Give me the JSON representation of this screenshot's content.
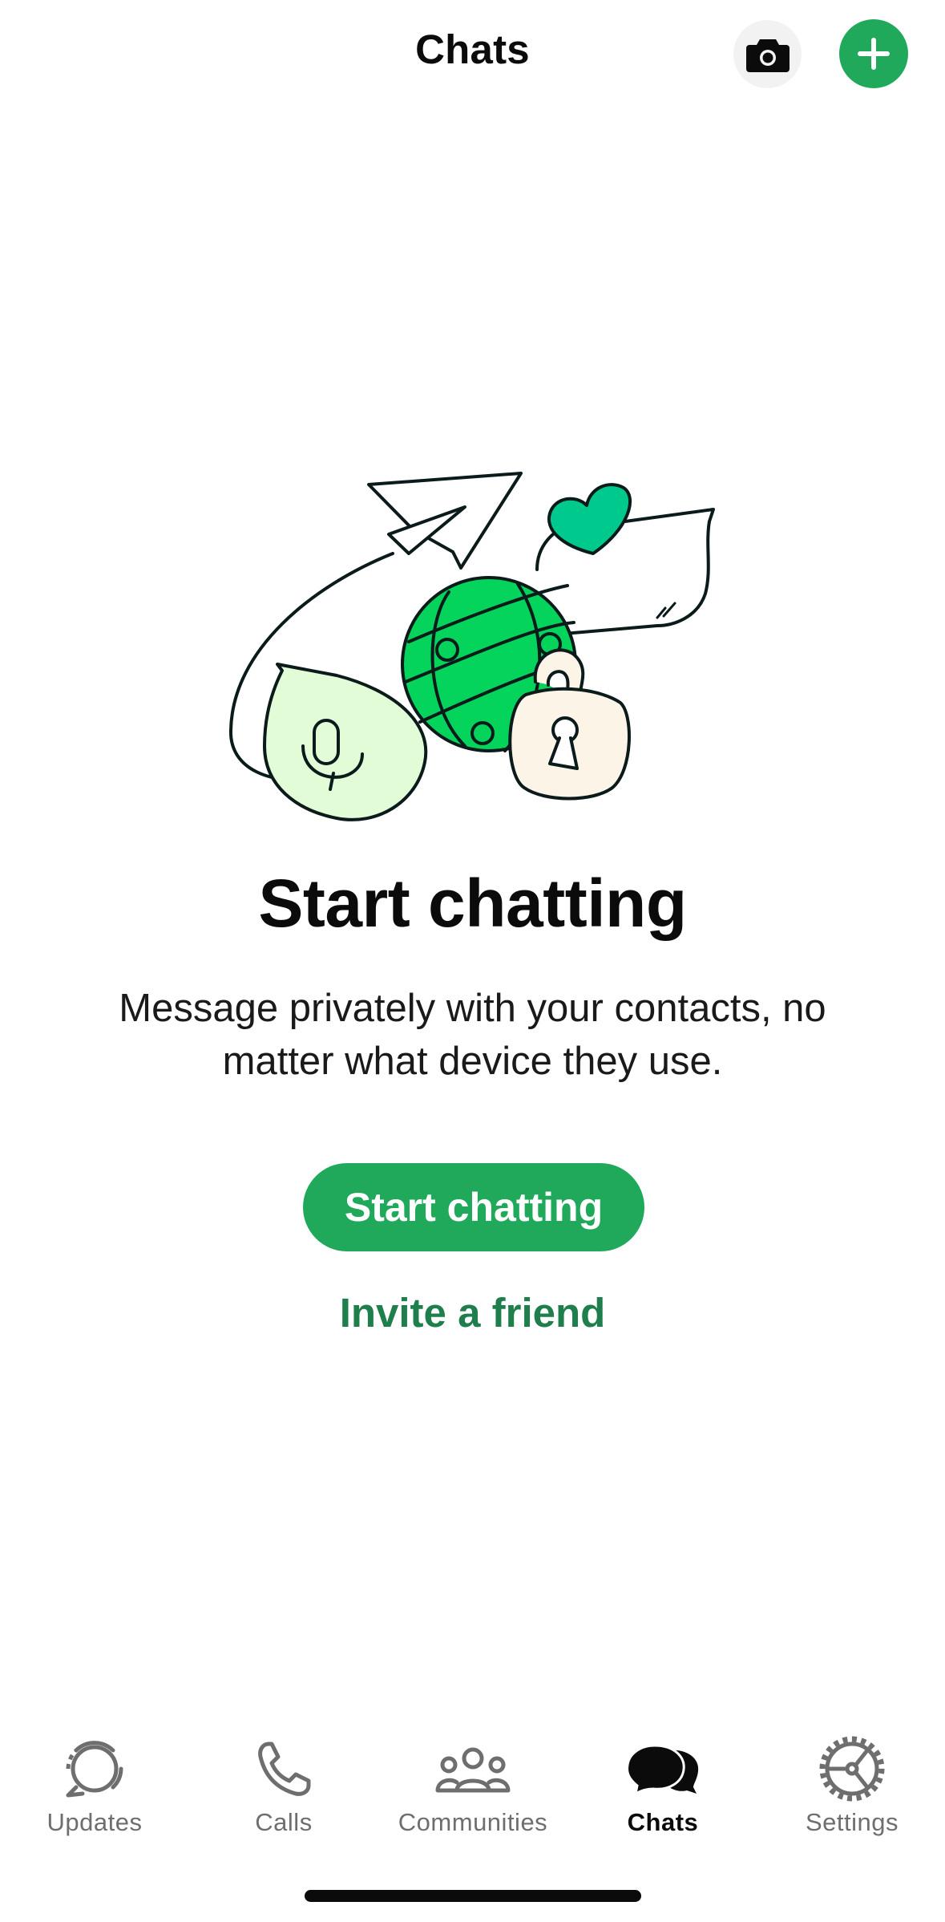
{
  "header": {
    "title": "Chats",
    "camera_icon": "camera-icon",
    "new_chat_icon": "plus-icon"
  },
  "empty_state": {
    "title": "Start chatting",
    "description": "Message privately with your contacts, no matter what device they use.",
    "primary_button": "Start chatting",
    "secondary_link": "Invite a friend"
  },
  "tabs": [
    {
      "label": "Updates",
      "icon": "updates-icon",
      "active": false
    },
    {
      "label": "Calls",
      "icon": "phone-icon",
      "active": false
    },
    {
      "label": "Communities",
      "icon": "communities-icon",
      "active": false
    },
    {
      "label": "Chats",
      "icon": "chats-icon",
      "active": true
    },
    {
      "label": "Settings",
      "icon": "gear-icon",
      "active": false
    }
  ],
  "colors": {
    "accent": "#21a95b",
    "link": "#1f7f4c",
    "globe": "#04d45b",
    "heart": "#00c98d",
    "mic_bubble": "#e2fcd8",
    "lock": "#fdf4e8"
  }
}
